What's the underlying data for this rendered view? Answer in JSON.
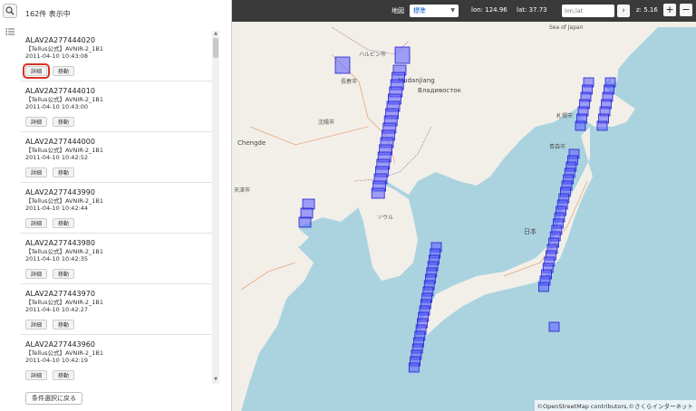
{
  "panel": {
    "count_text": "162件 表示中",
    "back_label": "条件選択に戻る",
    "items": [
      {
        "id": "ALAV2A277444020",
        "sub": "【Tellus公式】AVNIR-2_1B1",
        "date": "2011-04-10 10:43:08",
        "detail": "詳細",
        "move": "移動"
      },
      {
        "id": "ALAV2A277444010",
        "sub": "【Tellus公式】AVNIR-2_1B1",
        "date": "2011-04-10 10:43:00",
        "detail": "詳細",
        "move": "移動"
      },
      {
        "id": "ALAV2A277444000",
        "sub": "【Tellus公式】AVNIR-2_1B1",
        "date": "2011-04-10 10:42:52",
        "detail": "詳細",
        "move": "移動"
      },
      {
        "id": "ALAV2A277443990",
        "sub": "【Tellus公式】AVNIR-2_1B1",
        "date": "2011-04-10 10:42:44",
        "detail": "詳細",
        "move": "移動"
      },
      {
        "id": "ALAV2A277443980",
        "sub": "【Tellus公式】AVNIR-2_1B1",
        "date": "2011-04-10 10:42:35",
        "detail": "詳細",
        "move": "移動"
      },
      {
        "id": "ALAV2A277443970",
        "sub": "【Tellus公式】AVNIR-2_1B1",
        "date": "2011-04-10 10:42:27",
        "detail": "詳細",
        "move": "移動"
      },
      {
        "id": "ALAV2A277443960",
        "sub": "【Tellus公式】AVNIR-2_1B1",
        "date": "2011-04-10 10:42:19",
        "detail": "詳細",
        "move": "移動"
      }
    ]
  },
  "toolbar": {
    "map_label": "地図",
    "map_type": "標準",
    "lon": "lon: 124.96",
    "lat": "lat: 37.73",
    "lonlat_placeholder": "lon,lat",
    "zoom": "z: 5.16",
    "zoom_in": "+",
    "zoom_out": "−",
    "go": "›"
  },
  "map": {
    "attribution": "©OpenStreetMap contributors,©さくらインターネット",
    "labels": {
      "sea_of_japan": "Sea of Japan",
      "harbin": "ハルビン市",
      "changchun": "長春市",
      "mudanjiang": "Mudanjiang",
      "vladivostok": "Владивосток",
      "shenyang": "沈陽市",
      "chengde": "Chengde",
      "tianjin": "天津市",
      "seoul": "ソウル",
      "japan": "日本",
      "sapporo": "札幌市",
      "aomori": "青森市"
    }
  },
  "colors": {
    "footprint_fill": "#5a5aff",
    "footprint_stroke": "#1f1fd0",
    "land": "#f2efe9",
    "sea": "#aad3df",
    "highlight": "#d93025"
  }
}
